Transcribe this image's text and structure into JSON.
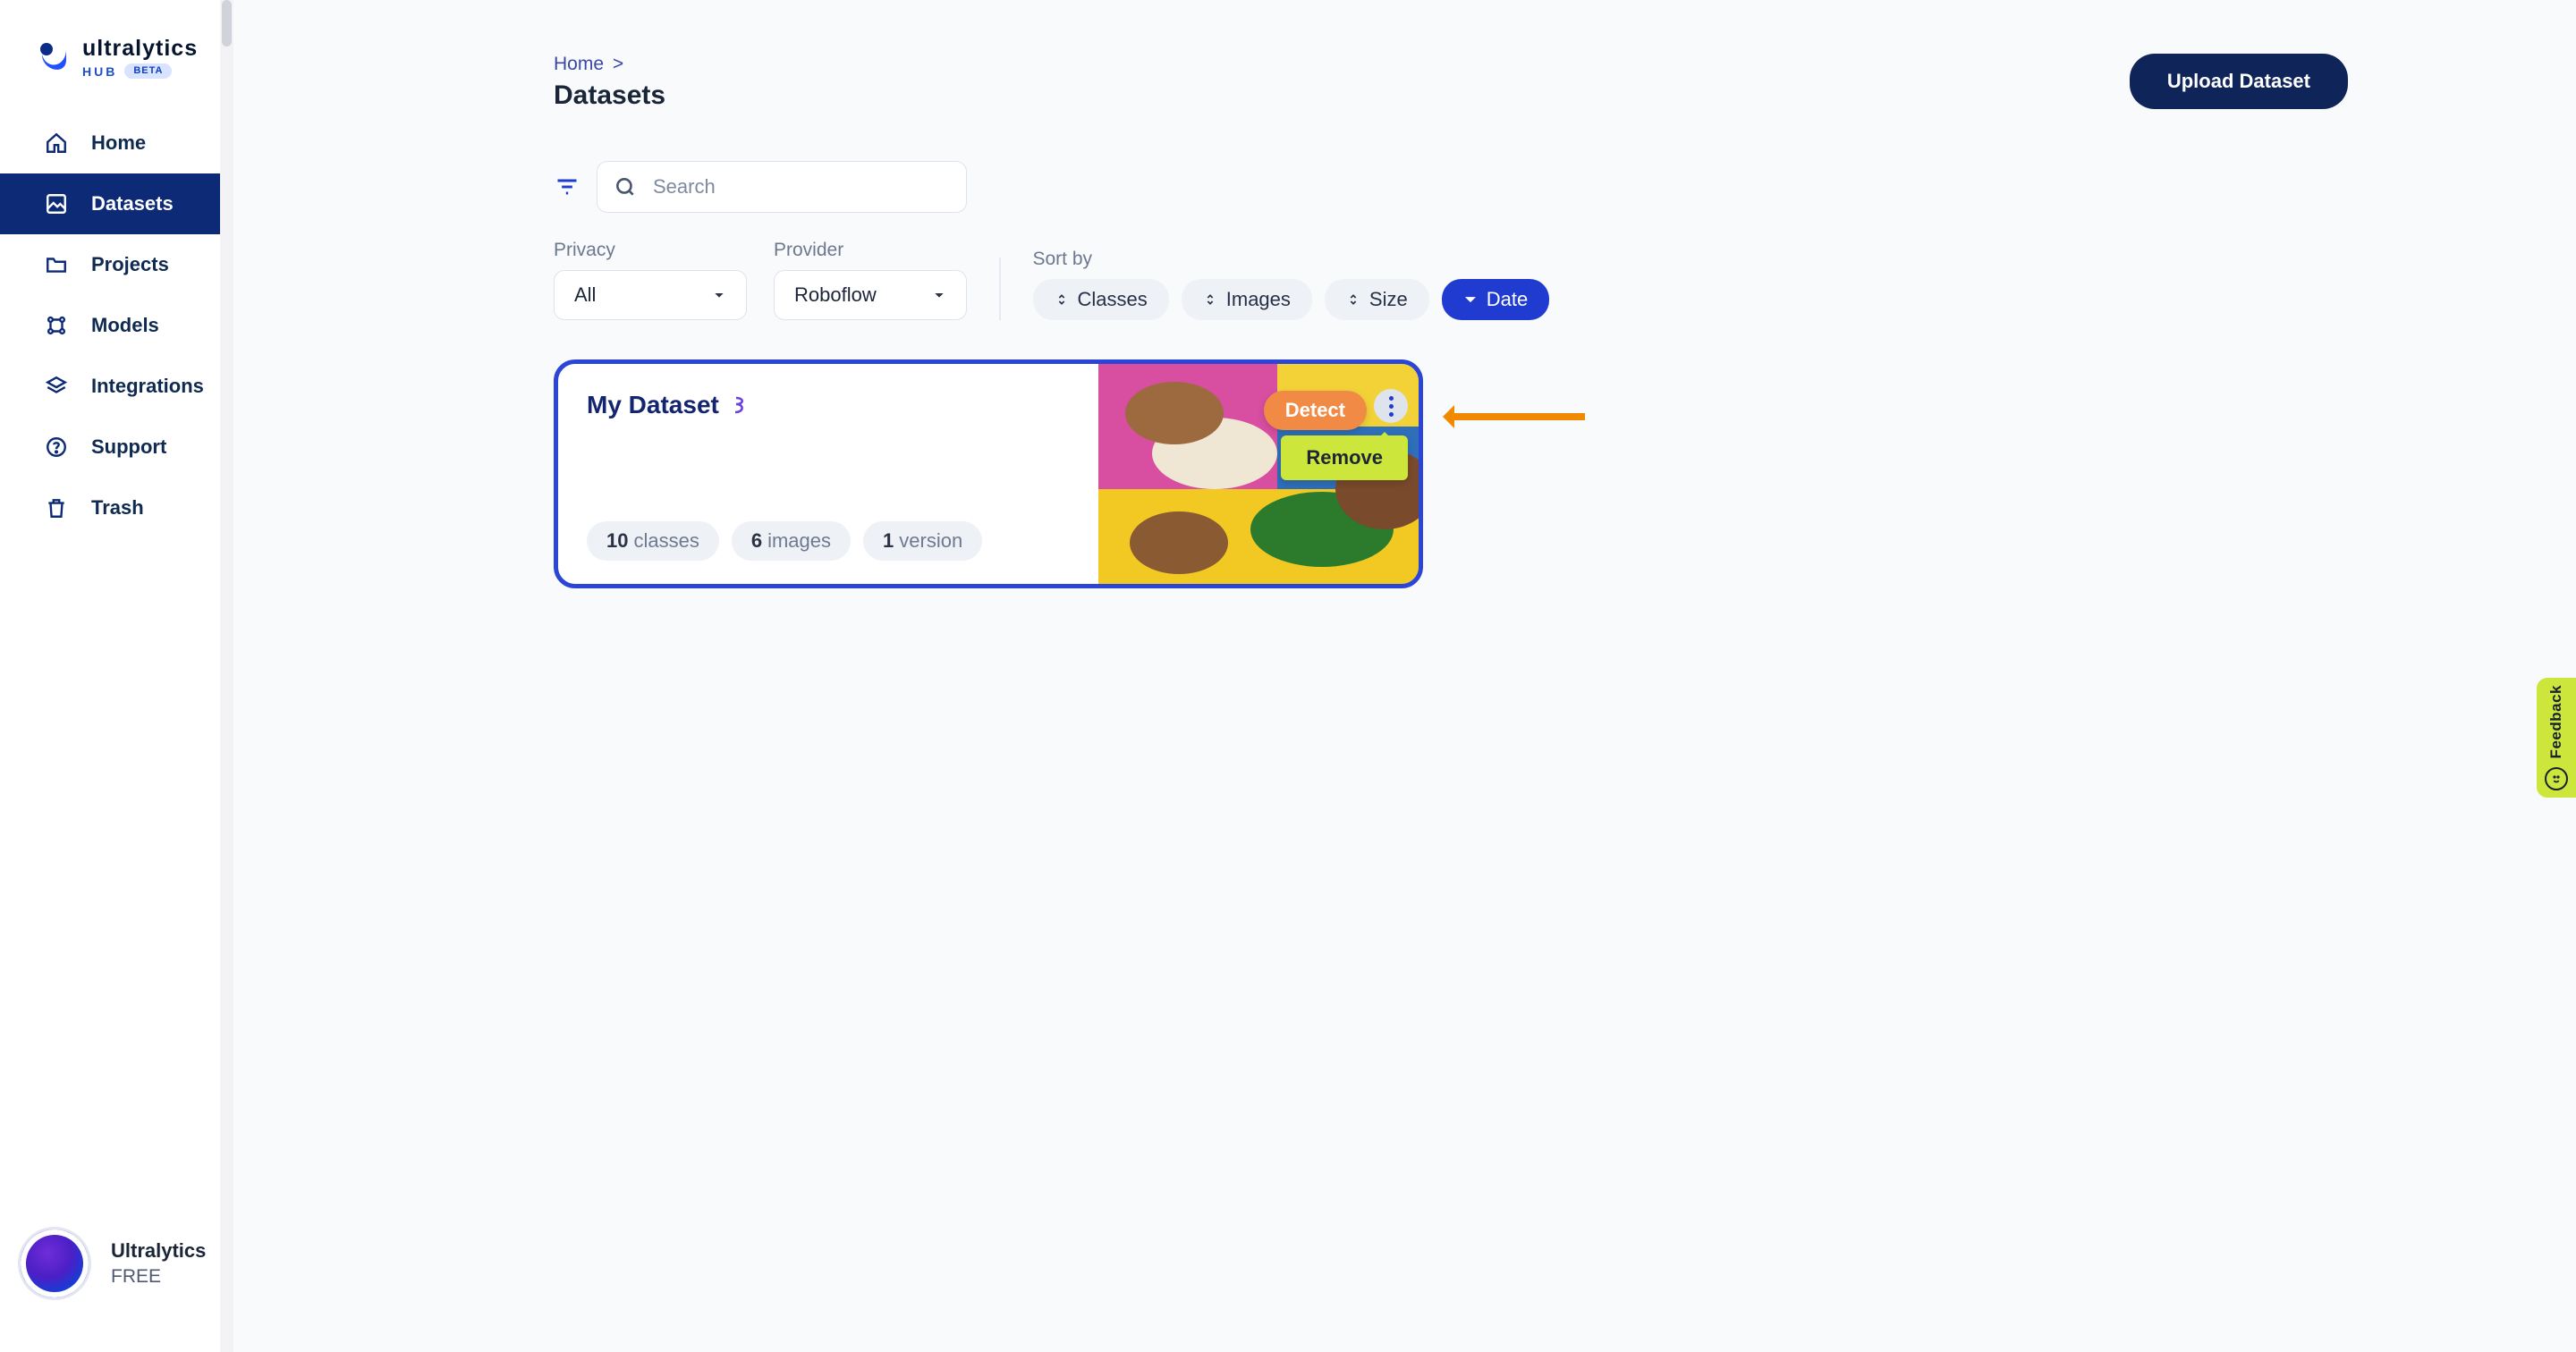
{
  "brand": {
    "name_top": "ultralytics",
    "hub": "HUB",
    "beta": "BETA"
  },
  "nav": {
    "home": "Home",
    "datasets": "Datasets",
    "projects": "Projects",
    "models": "Models",
    "integrations": "Integrations",
    "support": "Support",
    "trash": "Trash"
  },
  "user": {
    "name": "Ultralytics",
    "plan": "FREE"
  },
  "breadcrumb": {
    "home": "Home",
    "sep": ">"
  },
  "page": {
    "title": "Datasets"
  },
  "actions": {
    "upload": "Upload Dataset"
  },
  "search": {
    "placeholder": "Search"
  },
  "filters": {
    "privacy_label": "Privacy",
    "privacy_value": "All",
    "provider_label": "Provider",
    "provider_value": "Roboflow",
    "sort_label": "Sort by",
    "sort_classes": "Classes",
    "sort_images": "Images",
    "sort_size": "Size",
    "sort_date": "Date"
  },
  "card": {
    "title": "My Dataset",
    "detect": "Detect",
    "remove": "Remove",
    "stats": {
      "classes_n": "10",
      "classes_l": "classes",
      "images_n": "6",
      "images_l": "images",
      "versions_n": "1",
      "versions_l": "version"
    }
  },
  "feedback": {
    "label": "Feedback"
  }
}
